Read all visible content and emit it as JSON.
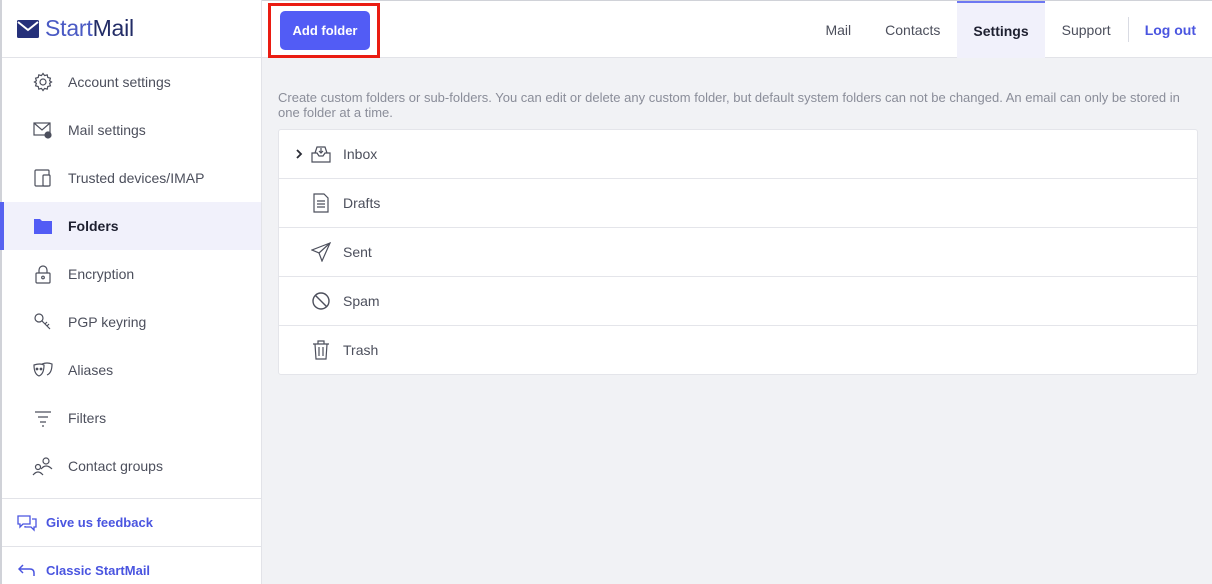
{
  "app": {
    "logo_start": "Start",
    "logo_mail": "Mail"
  },
  "sidebar": {
    "items": [
      {
        "label": "Account settings",
        "icon": "gear-icon"
      },
      {
        "label": "Mail settings",
        "icon": "mail-settings-icon"
      },
      {
        "label": "Trusted devices/IMAP",
        "icon": "devices-icon"
      },
      {
        "label": "Folders",
        "icon": "folder-icon",
        "active": true
      },
      {
        "label": "Encryption",
        "icon": "lock-icon"
      },
      {
        "label": "PGP keyring",
        "icon": "key-icon"
      },
      {
        "label": "Aliases",
        "icon": "masks-icon"
      },
      {
        "label": "Filters",
        "icon": "filter-icon"
      },
      {
        "label": "Contact groups",
        "icon": "contact-groups-icon"
      }
    ],
    "feedback_label": "Give us feedback",
    "classic_label": "Classic StartMail"
  },
  "toolbar": {
    "add_folder_label": "Add folder"
  },
  "tabs": [
    {
      "label": "Mail"
    },
    {
      "label": "Contacts"
    },
    {
      "label": "Settings",
      "active": true
    },
    {
      "label": "Support"
    },
    {
      "label": "Log out"
    }
  ],
  "main": {
    "description": "Create custom folders or sub-folders. You can edit or delete any custom folder, but default system folders can not be changed. An email can only be stored in one folder at a time.",
    "folders": [
      {
        "label": "Inbox",
        "icon": "inbox-icon",
        "expandable": true
      },
      {
        "label": "Drafts",
        "icon": "drafts-icon"
      },
      {
        "label": "Sent",
        "icon": "send-icon"
      },
      {
        "label": "Spam",
        "icon": "spam-icon"
      },
      {
        "label": "Trash",
        "icon": "trash-icon"
      }
    ]
  },
  "colors": {
    "accent": "#525cf5",
    "highlight": "#ea1c12",
    "link": "#4a55e0"
  }
}
